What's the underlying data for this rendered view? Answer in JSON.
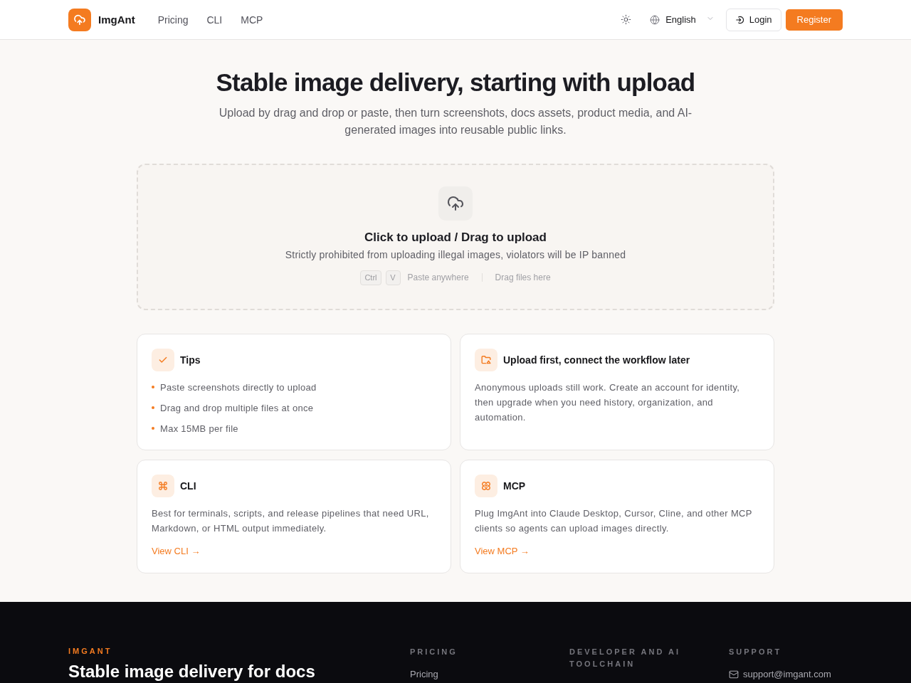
{
  "header": {
    "brand": "ImgAnt",
    "nav": [
      "Pricing",
      "CLI",
      "MCP"
    ],
    "language": "English",
    "login": "Login",
    "register": "Register"
  },
  "hero": {
    "title": "Stable image delivery, starting with upload",
    "subtitle": "Upload by drag and drop or paste, then turn screenshots, docs assets, product media, and AI-generated images into reusable public links."
  },
  "upload": {
    "title": "Click to upload / Drag to upload",
    "notice": "Strictly prohibited from uploading illegal images, violators will be IP banned",
    "keys": [
      "Ctrl",
      "V"
    ],
    "hints": [
      "Paste anywhere",
      "Drag files here"
    ]
  },
  "cards": [
    {
      "kind": "list",
      "title": "Tips",
      "items": [
        "Paste screenshots directly to upload",
        "Drag and drop multiple files at once",
        "Max 15MB per file"
      ]
    },
    {
      "kind": "text",
      "title": "Upload first, connect the workflow later",
      "text": "Anonymous uploads still work. Create an account for identity, then upgrade when you need history, organization, and automation."
    },
    {
      "kind": "text",
      "title": "CLI",
      "text": "Best for terminals, scripts, and release pipelines that need URL, Markdown, or HTML output immediately.",
      "link": "View CLI →"
    },
    {
      "kind": "text",
      "title": "MCP",
      "text": "Plug ImgAnt into Claude Desktop, Cursor, Cline, and other MCP clients so agents can upload images directly.",
      "link": "View MCP →"
    }
  ],
  "footer": {
    "brand": "IMGANT",
    "tagline": "Stable image delivery for docs",
    "columns": [
      {
        "heading": "PRICING",
        "links": [
          {
            "kind": "page",
            "label": "Pricing"
          }
        ]
      },
      {
        "heading": "DEVELOPER AND AI TOOLCHAIN"
      },
      {
        "heading": "SUPPORT",
        "links": [
          {
            "kind": "email",
            "label": "support@imgant.com"
          }
        ]
      }
    ]
  }
}
